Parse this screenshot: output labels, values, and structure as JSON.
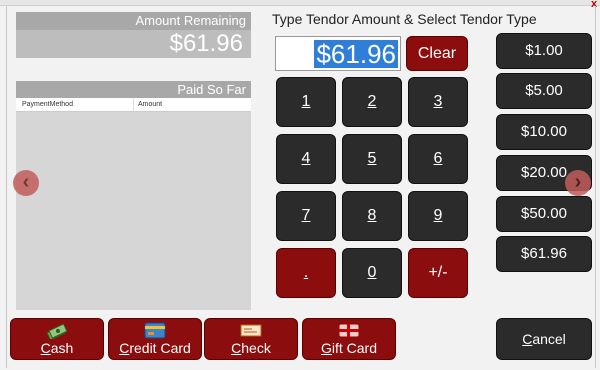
{
  "window": {
    "close_glyph": "x"
  },
  "left_panel": {
    "remaining_label": "Amount Remaining",
    "remaining_value": "$61.96",
    "paid_label": "Paid So Far",
    "paid_columns": [
      "PaymentMethod",
      "Amount"
    ]
  },
  "entry": {
    "title": "Type Tendor Amount & Select Tendor Type",
    "amount_value": "$61.96",
    "clear_label": "Clear"
  },
  "keypad": {
    "keys": [
      "1",
      "2",
      "3",
      "4",
      "5",
      "6",
      "7",
      "8",
      "9",
      ".",
      "0",
      "+/-"
    ]
  },
  "tender_buttons": [
    "$1.00",
    "$5.00",
    "$10.00",
    "$20.00",
    "$50.00",
    "$61.96"
  ],
  "payment_types": {
    "cash_first": "C",
    "cash_rest": "ash",
    "credit_first": "C",
    "credit_rest": "redit Card",
    "check_first": "C",
    "check_rest": "heck",
    "gift_first": "G",
    "gift_rest": "ift Card"
  },
  "cancel": {
    "first": "C",
    "rest": "ancel"
  },
  "nav": {
    "left_glyph": "‹",
    "right_glyph": "›"
  },
  "colors": {
    "accent_red": "#8b0d0d",
    "dark_button": "#2b2b2b",
    "selection_blue": "#2f7fd8"
  },
  "icons": {
    "cash": "cash-icon",
    "credit": "credit-card-icon",
    "check": "check-icon",
    "gift": "gift-card-icon"
  }
}
